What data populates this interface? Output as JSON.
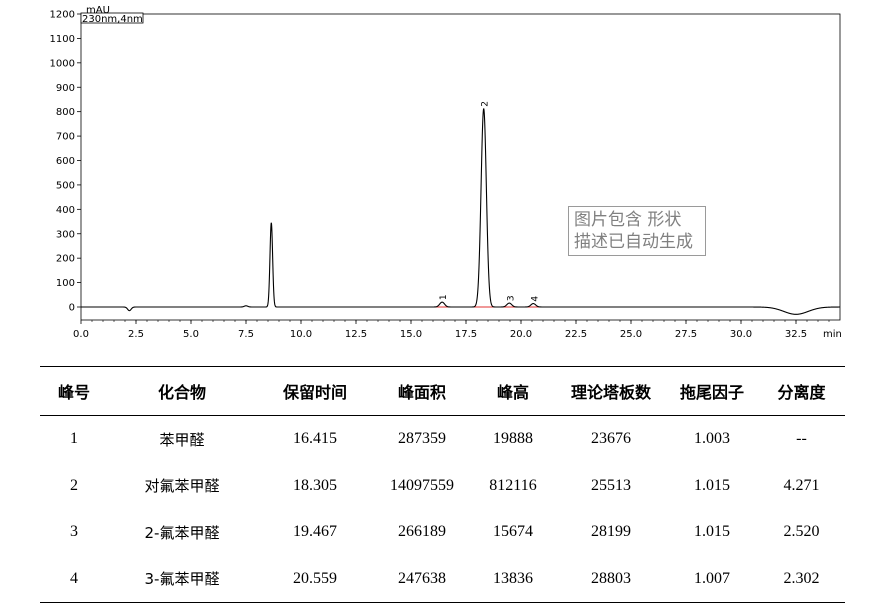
{
  "chart_data": {
    "type": "line",
    "y_unit": "mAU",
    "channel_label": "230nm,4nm",
    "x_unit": "min",
    "xlim": [
      0.0,
      34.5
    ],
    "ylim": [
      -50,
      1200
    ],
    "x_ticks": [
      "0.0",
      "2.5",
      "5.0",
      "7.5",
      "10.0",
      "12.5",
      "15.0",
      "17.5",
      "20.0",
      "22.5",
      "25.0",
      "27.5",
      "30.0",
      "32.5"
    ],
    "y_ticks": [
      "1200",
      "1100",
      "1000",
      "900",
      "800",
      "700",
      "600",
      "500",
      "400",
      "300",
      "200",
      "100",
      "0"
    ],
    "peaks": [
      {
        "label": "1",
        "rt": 16.415,
        "height": 20
      },
      {
        "label": "2",
        "rt": 18.305,
        "height": 812
      },
      {
        "label": "3",
        "rt": 19.467,
        "height": 16
      },
      {
        "label": "4",
        "rt": 20.559,
        "height": 14
      }
    ],
    "other_features": [
      {
        "rt": 2.2,
        "height": -15
      },
      {
        "rt": 7.5,
        "height": 5
      },
      {
        "rt": 8.65,
        "height": 345
      },
      {
        "rt": 32.5,
        "height": -30
      }
    ],
    "series_color": "#000000",
    "baseline_color": "#e03030"
  },
  "overlay": {
    "line1": "图片包含 形状",
    "line2": "描述已自动生成"
  },
  "table": {
    "headers": [
      "峰号",
      "化合物",
      "保留时间",
      "峰面积",
      "峰高",
      "理论塔板数",
      "拖尾因子",
      "分离度"
    ],
    "rows": [
      [
        "1",
        "苯甲醛",
        "16.415",
        "287359",
        "19888",
        "23676",
        "1.003",
        "--"
      ],
      [
        "2",
        "对氟苯甲醛",
        "18.305",
        "14097559",
        "812116",
        "25513",
        "1.015",
        "4.271"
      ],
      [
        "3",
        "2-氟苯甲醛",
        "19.467",
        "266189",
        "15674",
        "28199",
        "1.015",
        "2.520"
      ],
      [
        "4",
        "3-氟苯甲醛",
        "20.559",
        "247638",
        "13836",
        "28803",
        "1.007",
        "2.302"
      ]
    ]
  }
}
